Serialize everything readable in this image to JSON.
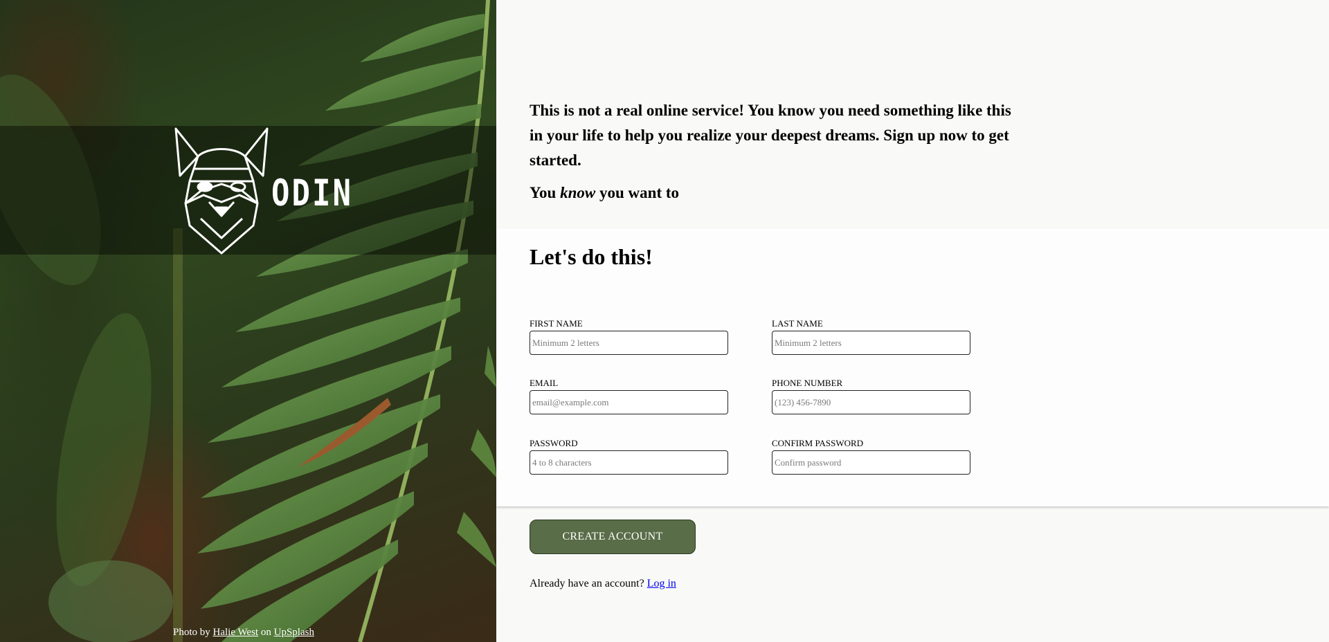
{
  "hero": {
    "logo_icon": "viking-helmet-logo",
    "logo_text": "ODIN",
    "credit": {
      "prefix": "Photo by",
      "author": "Halie West",
      "middle": "on",
      "source": "UpSplash"
    }
  },
  "intro": {
    "lead": "This is not a real online service! You know you need something like this in your life to help you realize your deepest dreams. Sign up now to get started.",
    "want_before": "You",
    "want_emph": "know",
    "want_after": "you want to"
  },
  "form": {
    "title": "Let's do this!",
    "fields": {
      "first_name": {
        "label": "FIRST NAME",
        "placeholder": "Minimum 2 letters",
        "value": ""
      },
      "last_name": {
        "label": "LAST NAME",
        "placeholder": "Minimum 2 letters",
        "value": ""
      },
      "email": {
        "label": "EMAIL",
        "placeholder": "email@example.com",
        "value": ""
      },
      "phone": {
        "label": "PHONE NUMBER",
        "placeholder": "(123) 456-7890",
        "value": ""
      },
      "password": {
        "label": "PASSWORD",
        "placeholder": "4 to 8 characters",
        "value": ""
      },
      "confirm_password": {
        "label": "CONFIRM PASSWORD",
        "placeholder": "Confirm password",
        "value": ""
      }
    },
    "submit_label": "CREATE ACCOUNT",
    "login_prompt": "Already have an account?",
    "login_link": "Log in"
  },
  "colors": {
    "button_bg": "#596d48",
    "link": "#0000ee",
    "panel_bg": "#f9faf8"
  }
}
